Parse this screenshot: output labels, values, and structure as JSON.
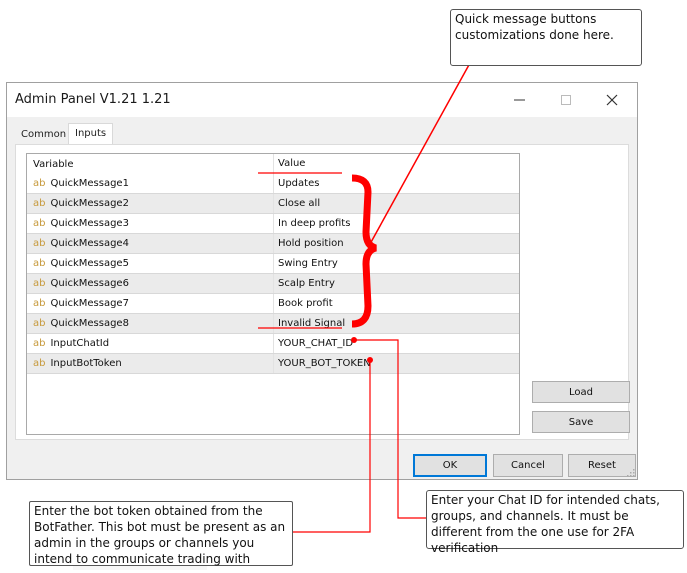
{
  "window": {
    "title": "Admin Panel V1.21 1.21",
    "controls": {
      "minimize": "minimize-icon",
      "maximize": "maximize-icon",
      "close": "close-icon"
    }
  },
  "tabs": [
    {
      "label": "Common",
      "active": false
    },
    {
      "label": "Inputs",
      "active": true
    }
  ],
  "grid": {
    "columns": [
      "Variable",
      "Value"
    ],
    "type_icon_text": "ab",
    "rows": [
      {
        "variable": "QuickMessage1",
        "value": "Updates"
      },
      {
        "variable": "QuickMessage2",
        "value": "Close all"
      },
      {
        "variable": "QuickMessage3",
        "value": "In deep profits"
      },
      {
        "variable": "QuickMessage4",
        "value": "Hold position"
      },
      {
        "variable": "QuickMessage5",
        "value": "Swing Entry"
      },
      {
        "variable": "QuickMessage6",
        "value": "Scalp Entry"
      },
      {
        "variable": "QuickMessage7",
        "value": "Book profit"
      },
      {
        "variable": "QuickMessage8",
        "value": "Invalid Signal"
      },
      {
        "variable": "InputChatId",
        "value": "YOUR_CHAT_ID"
      },
      {
        "variable": "InputBotToken",
        "value": "YOUR_BOT_TOKEN"
      }
    ]
  },
  "side_buttons": {
    "load": "Load",
    "save": "Save"
  },
  "footer_buttons": {
    "ok": "OK",
    "cancel": "Cancel",
    "reset": "Reset"
  },
  "annotations": {
    "quick_message": "Quick message buttons customizations done here.",
    "bot_token": "Enter the bot token obtained from the BotFather. This bot must be present as an admin in the groups or  channels you intend to communicate trading with",
    "chat_id": "Enter your Chat ID for intended chats, groups, and channels. It must be different from the one use for 2FA verification",
    "annotation_color": "#ff0000"
  }
}
